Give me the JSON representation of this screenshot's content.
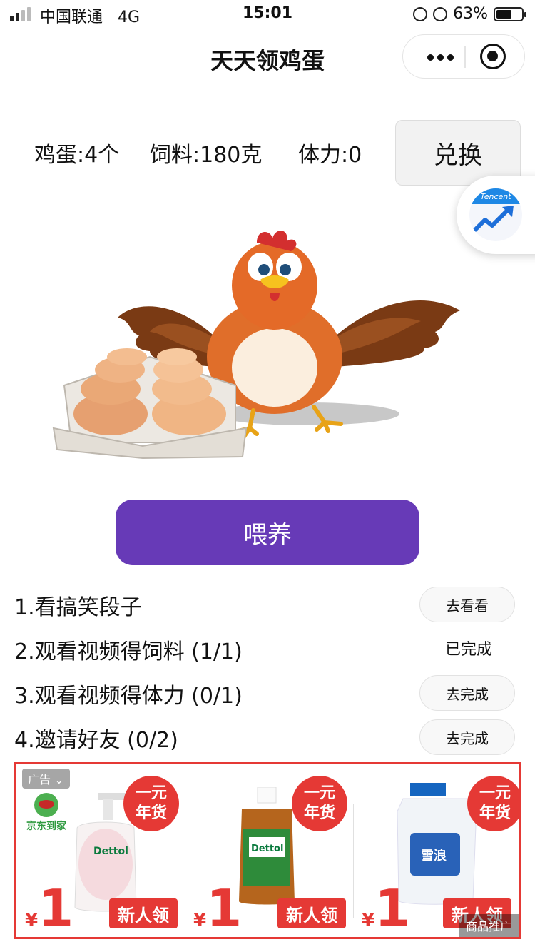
{
  "status_bar": {
    "carrier": "中国联通",
    "network": "4G",
    "time": "15:01",
    "battery": "63%",
    "battery_level": 0.63
  },
  "nav": {
    "title": "天天领鸡蛋",
    "more_icon": "more-dots-icon",
    "close_icon": "target-close-icon"
  },
  "stats": {
    "eggs": "鸡蛋:4个",
    "feed": "饲料:180克",
    "stamina": "体力:0",
    "exchange_label": "兑换"
  },
  "float_button": {
    "brand": "Tencent",
    "icon": "trend-up-icon"
  },
  "feed_button": {
    "label": "喂养",
    "color": "#673ab7"
  },
  "tasks": [
    {
      "label": "1.看搞笑段子",
      "action": "去看看",
      "done": false
    },
    {
      "label": "2.观看视频得饲料 (1/1)",
      "action": "已完成",
      "done": true
    },
    {
      "label": "3.观看视频得体力 (0/1)",
      "action": "去完成",
      "done": false
    },
    {
      "label": "4.邀请好友 (0/2)",
      "action": "去完成",
      "done": false
    }
  ],
  "ad": {
    "tag": "广告",
    "brand": "京东到家",
    "promo_label": "商品推广",
    "accent": "#e53935",
    "items": [
      {
        "badge_line1": "一元",
        "badge_line2": "年货",
        "currency": "¥",
        "price": "1",
        "cta": "新人领",
        "product_text": "Dettol"
      },
      {
        "badge_line1": "一元",
        "badge_line2": "年货",
        "currency": "¥",
        "price": "1",
        "cta": "新人领",
        "product_text": "Dettol"
      },
      {
        "badge_line1": "一元",
        "badge_line2": "年货",
        "currency": "¥",
        "price": "1",
        "cta": "新人领",
        "product_text": "雪浪"
      }
    ]
  }
}
